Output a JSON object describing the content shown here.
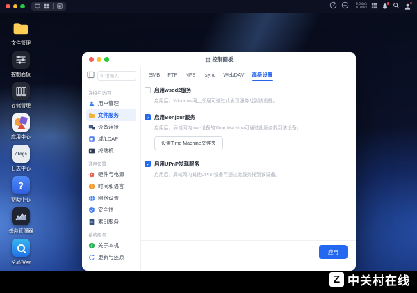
{
  "menubar": {
    "up_speed": "0.0kb/s",
    "down_speed": "0.0kb/s"
  },
  "desktop": {
    "icons": [
      {
        "label": "文件管理"
      },
      {
        "label": "控制面板"
      },
      {
        "label": "存储管理"
      },
      {
        "label": "应用中心"
      },
      {
        "label": "日志中心",
        "glyph": "/logs"
      },
      {
        "label": "帮助中心",
        "glyph": "?"
      },
      {
        "label": "任务管理器"
      },
      {
        "label": "全局搜索"
      }
    ]
  },
  "window": {
    "title": "控制面板",
    "search_placeholder": "请输入",
    "sidebar": {
      "sections": [
        {
          "title": "连接与访问",
          "items": [
            {
              "label": "用户管理"
            },
            {
              "label": "文件服务",
              "active": true
            },
            {
              "label": "设备连接"
            },
            {
              "label": "域/LDAP"
            },
            {
              "label": "终端机"
            }
          ]
        },
        {
          "title": "通用设置",
          "items": [
            {
              "label": "硬件与电源"
            },
            {
              "label": "时间和语言"
            },
            {
              "label": "网络设置"
            },
            {
              "label": "安全性"
            },
            {
              "label": "索引服务"
            }
          ]
        },
        {
          "title": "系统服务",
          "items": [
            {
              "label": "关于本机"
            },
            {
              "label": "更新与还原"
            }
          ]
        }
      ]
    },
    "tabs": [
      {
        "label": "SMB"
      },
      {
        "label": "FTP"
      },
      {
        "label": "NFS"
      },
      {
        "label": "rsync"
      },
      {
        "label": "WebDAV"
      },
      {
        "label": "高级设置",
        "active": true
      }
    ],
    "settings": [
      {
        "checked": false,
        "label": "启用wsdd2服务",
        "desc": "启用后，Windows网上邻居可通过此发现服务找到该设备。"
      },
      {
        "checked": true,
        "label": "启用Bonjour服务",
        "desc": "启用后，局域网内mac设备的Time Machine可通过此服务找到该设备。",
        "button": "设置Time Machine文件夹"
      },
      {
        "checked": true,
        "label": "启用UPnP发现服务",
        "desc": "启用后，局域网内其他UPnP设备可通过此服务找到该设备。"
      }
    ],
    "apply_label": "应用"
  },
  "watermark": {
    "text": "中关村在线",
    "logo_glyph": "Z"
  },
  "colors": {
    "accent": "#2468f2",
    "active_tab": "#2563eb",
    "wallpaper_blue": "#3b6fd8"
  }
}
